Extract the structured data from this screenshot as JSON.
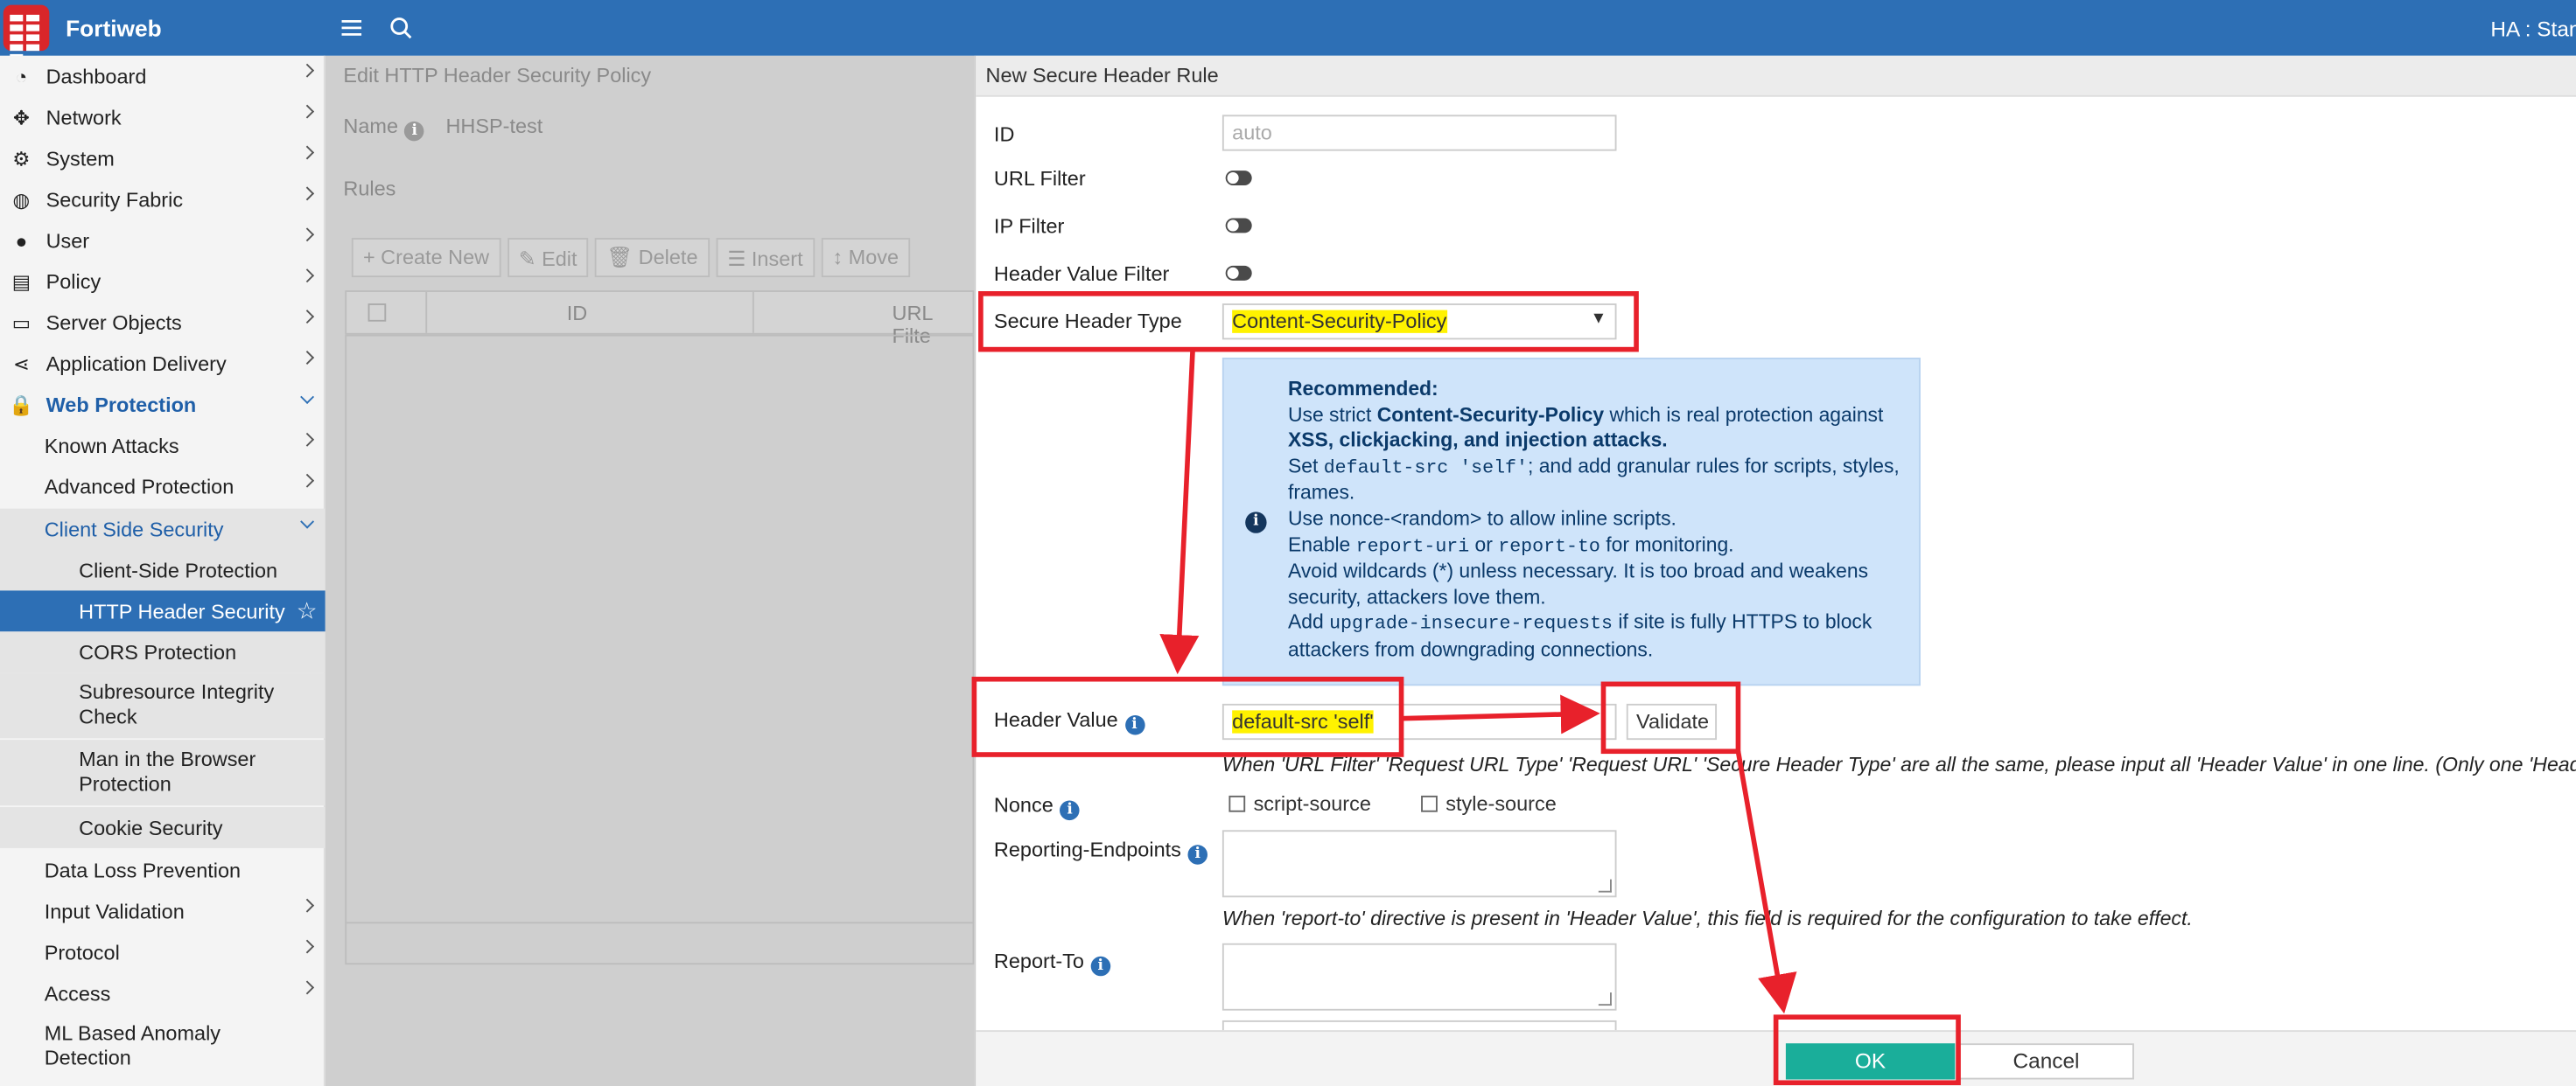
{
  "topbar": {
    "brand": "Fortiweb",
    "ha": "HA : Stan"
  },
  "sidebar": {
    "dashboard": "Dashboard",
    "network": "Network",
    "system": "System",
    "security_fabric": "Security Fabric",
    "user": "User",
    "policy": "Policy",
    "server_objects": "Server Objects",
    "application_delivery": "Application Delivery",
    "web_protection": "Web Protection",
    "known_attacks": "Known Attacks",
    "advanced_protection": "Advanced Protection",
    "client_side_security": "Client Side Security",
    "client_side_protection": "Client-Side Protection",
    "http_header_security": "HTTP Header Security",
    "cors_protection": "CORS Protection",
    "sri_check": "Subresource Integrity Check",
    "mitb_protection": "Man in the Browser Protection",
    "cookie_security": "Cookie Security",
    "data_loss_prevention": "Data Loss Prevention",
    "input_validation": "Input Validation",
    "protocol": "Protocol",
    "access": "Access",
    "ml_anomaly": "ML Based Anomaly Detection"
  },
  "main": {
    "title": "Edit HTTP Header Security Policy",
    "name_label": "Name",
    "name_value": "HHSP-test",
    "rules_label": "Rules",
    "toolbar": {
      "create_new": "Create New",
      "edit": "Edit",
      "delete": "Delete",
      "insert": "Insert",
      "move": "Move"
    },
    "columns": {
      "id": "ID",
      "url_filter": "URL Filte"
    }
  },
  "panel": {
    "title": "New Secure Header Rule",
    "id_label": "ID",
    "id_placeholder": "auto",
    "url_filter_label": "URL Filter",
    "ip_filter_label": "IP Filter",
    "header_value_filter_label": "Header Value Filter",
    "secure_header_type_label": "Secure Header Type",
    "secure_header_type_value": "Content-Security-Policy",
    "recommended": {
      "title": "Recommended:",
      "l1a": "Use strict ",
      "l1b": "Content-Security-Policy",
      "l1c": " which is real protection against ",
      "l1d": "XSS, clickjacking, and injection attacks.",
      "l2a": "Set ",
      "l2code": "default-src 'self'",
      "l2b": "; and add granular rules for scripts, styles, frames.",
      "l3": "Use nonce-<random> to allow inline scripts.",
      "l4a": "Enable ",
      "l4code1": "report-uri",
      "l4b": " or ",
      "l4code2": "report-to",
      "l4c": " for monitoring.",
      "l5": "Avoid wildcards (*) unless necessary. It is too broad and weakens security, attackers love them.",
      "l6a": "Add ",
      "l6code": "upgrade-insecure-requests",
      "l6b": " if site is fully HTTPS to block attackers from downgrading connections."
    },
    "header_value_label": "Header Value",
    "header_value": "default-src 'self'",
    "validate_label": "Validate",
    "header_value_note": "When 'URL Filter' 'Request URL Type' 'Request URL' 'Secure Header Type' are all the same, please input all 'Header Value' in one line. (Only one 'Header Value' is",
    "nonce_label": "Nonce",
    "script_source": "script-source",
    "style_source": "style-source",
    "reporting_endpoints_label": "Reporting-Endpoints",
    "report_to_note": "When 'report-to' directive is present in 'Header Value', this field is required for the configuration to take effect.",
    "report_to_label": "Report-To",
    "ok_label": "OK",
    "cancel_label": "Cancel"
  },
  "colors": {
    "topbar": "#2d6fb5",
    "accent": "#2d6fb5",
    "ok": "#1aae9a",
    "annotation": "#e8212b",
    "highlight": "#fff200"
  }
}
